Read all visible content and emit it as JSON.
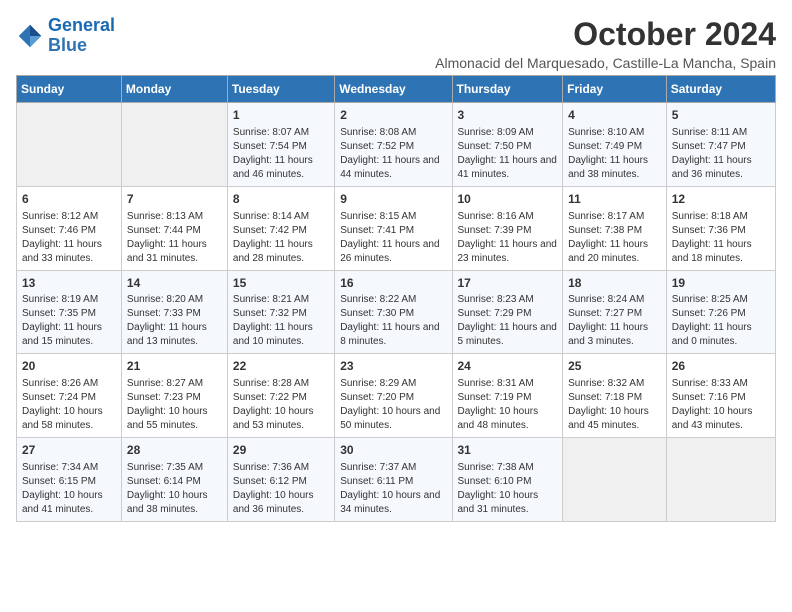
{
  "logo": {
    "line1": "General",
    "line2": "Blue"
  },
  "title": "October 2024",
  "subtitle": "Almonacid del Marquesado, Castille-La Mancha, Spain",
  "header_days": [
    "Sunday",
    "Monday",
    "Tuesday",
    "Wednesday",
    "Thursday",
    "Friday",
    "Saturday"
  ],
  "weeks": [
    [
      {
        "day": "",
        "info": ""
      },
      {
        "day": "",
        "info": ""
      },
      {
        "day": "1",
        "info": "Sunrise: 8:07 AM\nSunset: 7:54 PM\nDaylight: 11 hours and 46 minutes."
      },
      {
        "day": "2",
        "info": "Sunrise: 8:08 AM\nSunset: 7:52 PM\nDaylight: 11 hours and 44 minutes."
      },
      {
        "day": "3",
        "info": "Sunrise: 8:09 AM\nSunset: 7:50 PM\nDaylight: 11 hours and 41 minutes."
      },
      {
        "day": "4",
        "info": "Sunrise: 8:10 AM\nSunset: 7:49 PM\nDaylight: 11 hours and 38 minutes."
      },
      {
        "day": "5",
        "info": "Sunrise: 8:11 AM\nSunset: 7:47 PM\nDaylight: 11 hours and 36 minutes."
      }
    ],
    [
      {
        "day": "6",
        "info": "Sunrise: 8:12 AM\nSunset: 7:46 PM\nDaylight: 11 hours and 33 minutes."
      },
      {
        "day": "7",
        "info": "Sunrise: 8:13 AM\nSunset: 7:44 PM\nDaylight: 11 hours and 31 minutes."
      },
      {
        "day": "8",
        "info": "Sunrise: 8:14 AM\nSunset: 7:42 PM\nDaylight: 11 hours and 28 minutes."
      },
      {
        "day": "9",
        "info": "Sunrise: 8:15 AM\nSunset: 7:41 PM\nDaylight: 11 hours and 26 minutes."
      },
      {
        "day": "10",
        "info": "Sunrise: 8:16 AM\nSunset: 7:39 PM\nDaylight: 11 hours and 23 minutes."
      },
      {
        "day": "11",
        "info": "Sunrise: 8:17 AM\nSunset: 7:38 PM\nDaylight: 11 hours and 20 minutes."
      },
      {
        "day": "12",
        "info": "Sunrise: 8:18 AM\nSunset: 7:36 PM\nDaylight: 11 hours and 18 minutes."
      }
    ],
    [
      {
        "day": "13",
        "info": "Sunrise: 8:19 AM\nSunset: 7:35 PM\nDaylight: 11 hours and 15 minutes."
      },
      {
        "day": "14",
        "info": "Sunrise: 8:20 AM\nSunset: 7:33 PM\nDaylight: 11 hours and 13 minutes."
      },
      {
        "day": "15",
        "info": "Sunrise: 8:21 AM\nSunset: 7:32 PM\nDaylight: 11 hours and 10 minutes."
      },
      {
        "day": "16",
        "info": "Sunrise: 8:22 AM\nSunset: 7:30 PM\nDaylight: 11 hours and 8 minutes."
      },
      {
        "day": "17",
        "info": "Sunrise: 8:23 AM\nSunset: 7:29 PM\nDaylight: 11 hours and 5 minutes."
      },
      {
        "day": "18",
        "info": "Sunrise: 8:24 AM\nSunset: 7:27 PM\nDaylight: 11 hours and 3 minutes."
      },
      {
        "day": "19",
        "info": "Sunrise: 8:25 AM\nSunset: 7:26 PM\nDaylight: 11 hours and 0 minutes."
      }
    ],
    [
      {
        "day": "20",
        "info": "Sunrise: 8:26 AM\nSunset: 7:24 PM\nDaylight: 10 hours and 58 minutes."
      },
      {
        "day": "21",
        "info": "Sunrise: 8:27 AM\nSunset: 7:23 PM\nDaylight: 10 hours and 55 minutes."
      },
      {
        "day": "22",
        "info": "Sunrise: 8:28 AM\nSunset: 7:22 PM\nDaylight: 10 hours and 53 minutes."
      },
      {
        "day": "23",
        "info": "Sunrise: 8:29 AM\nSunset: 7:20 PM\nDaylight: 10 hours and 50 minutes."
      },
      {
        "day": "24",
        "info": "Sunrise: 8:31 AM\nSunset: 7:19 PM\nDaylight: 10 hours and 48 minutes."
      },
      {
        "day": "25",
        "info": "Sunrise: 8:32 AM\nSunset: 7:18 PM\nDaylight: 10 hours and 45 minutes."
      },
      {
        "day": "26",
        "info": "Sunrise: 8:33 AM\nSunset: 7:16 PM\nDaylight: 10 hours and 43 minutes."
      }
    ],
    [
      {
        "day": "27",
        "info": "Sunrise: 7:34 AM\nSunset: 6:15 PM\nDaylight: 10 hours and 41 minutes."
      },
      {
        "day": "28",
        "info": "Sunrise: 7:35 AM\nSunset: 6:14 PM\nDaylight: 10 hours and 38 minutes."
      },
      {
        "day": "29",
        "info": "Sunrise: 7:36 AM\nSunset: 6:12 PM\nDaylight: 10 hours and 36 minutes."
      },
      {
        "day": "30",
        "info": "Sunrise: 7:37 AM\nSunset: 6:11 PM\nDaylight: 10 hours and 34 minutes."
      },
      {
        "day": "31",
        "info": "Sunrise: 7:38 AM\nSunset: 6:10 PM\nDaylight: 10 hours and 31 minutes."
      },
      {
        "day": "",
        "info": ""
      },
      {
        "day": "",
        "info": ""
      }
    ]
  ]
}
